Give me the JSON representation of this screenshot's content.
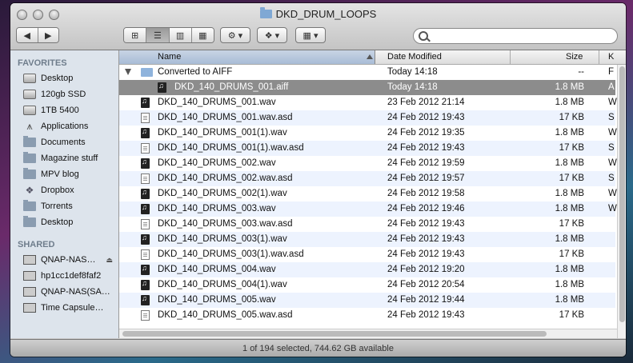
{
  "window": {
    "title": "DKD_DRUM_LOOPS"
  },
  "toolbar": {
    "back_label": "◀",
    "forward_label": "▶",
    "view_icons": [
      "⊞",
      "☰",
      "▥",
      "▦"
    ],
    "action_label": "⚙ ▾",
    "dropbox_label": "❖ ▾",
    "arrange_label": "▦ ▾",
    "search_placeholder": ""
  },
  "sidebar": {
    "favorites_header": "FAVORITES",
    "favorites": [
      {
        "label": "Desktop",
        "icon": "disk-icon"
      },
      {
        "label": "120gb SSD",
        "icon": "disk-icon"
      },
      {
        "label": "1TB 5400",
        "icon": "disk-icon"
      },
      {
        "label": "Applications",
        "icon": "applications-icon"
      },
      {
        "label": "Documents",
        "icon": "folder-icon"
      },
      {
        "label": "Magazine stuff",
        "icon": "folder-icon"
      },
      {
        "label": "MPV blog",
        "icon": "folder-icon"
      },
      {
        "label": "Dropbox",
        "icon": "dropbox-icon"
      },
      {
        "label": "Torrents",
        "icon": "folder-icon"
      },
      {
        "label": "Desktop",
        "icon": "folder-icon"
      }
    ],
    "shared_header": "SHARED",
    "shared": [
      {
        "label": "QNAP-NAS…",
        "icon": "network-icon",
        "eject": "⏏"
      },
      {
        "label": "hp1cc1def8faf2",
        "icon": "network-icon"
      },
      {
        "label": "QNAP-NAS(SA…",
        "icon": "network-icon"
      },
      {
        "label": "Time Capsule…",
        "icon": "network-icon"
      }
    ]
  },
  "columns": {
    "name": "Name",
    "date": "Date Modified",
    "size": "Size",
    "kind": "K"
  },
  "rows": [
    {
      "name": "Converted to AIFF",
      "date": "Today 14:18",
      "size": "--",
      "kind": "F",
      "type": "folder",
      "indent": 0
    },
    {
      "name": "DKD_140_DRUMS_001.aiff",
      "date": "Today 14:18",
      "size": "1.8 MB",
      "kind": "A",
      "type": "audio",
      "indent": 1,
      "selected": true
    },
    {
      "name": "DKD_140_DRUMS_001.wav",
      "date": "23 Feb 2012 21:14",
      "size": "1.8 MB",
      "kind": "W",
      "type": "audio",
      "indent": 0
    },
    {
      "name": "DKD_140_DRUMS_001.wav.asd",
      "date": "24 Feb 2012 19:43",
      "size": "17 KB",
      "kind": "S",
      "type": "doc",
      "indent": 0
    },
    {
      "name": "DKD_140_DRUMS_001(1).wav",
      "date": "24 Feb 2012 19:35",
      "size": "1.8 MB",
      "kind": "W",
      "type": "audio",
      "indent": 0
    },
    {
      "name": "DKD_140_DRUMS_001(1).wav.asd",
      "date": "24 Feb 2012 19:43",
      "size": "17 KB",
      "kind": "S",
      "type": "doc",
      "indent": 0
    },
    {
      "name": "DKD_140_DRUMS_002.wav",
      "date": "24 Feb 2012 19:59",
      "size": "1.8 MB",
      "kind": "W",
      "type": "audio",
      "indent": 0
    },
    {
      "name": "DKD_140_DRUMS_002.wav.asd",
      "date": "24 Feb 2012 19:57",
      "size": "17 KB",
      "kind": "S",
      "type": "doc",
      "indent": 0
    },
    {
      "name": "DKD_140_DRUMS_002(1).wav",
      "date": "24 Feb 2012 19:58",
      "size": "1.8 MB",
      "kind": "W",
      "type": "audio",
      "indent": 0
    },
    {
      "name": "DKD_140_DRUMS_003.wav",
      "date": "24 Feb 2012 19:46",
      "size": "1.8 MB",
      "kind": "W",
      "type": "audio",
      "indent": 0
    },
    {
      "name": "DKD_140_DRUMS_003.wav.asd",
      "date": "24 Feb 2012 19:43",
      "size": "17 KB",
      "kind": "",
      "type": "doc",
      "indent": 0
    },
    {
      "name": "DKD_140_DRUMS_003(1).wav",
      "date": "24 Feb 2012 19:43",
      "size": "1.8 MB",
      "kind": "",
      "type": "audio",
      "indent": 0
    },
    {
      "name": "DKD_140_DRUMS_003(1).wav.asd",
      "date": "24 Feb 2012 19:43",
      "size": "17 KB",
      "kind": "",
      "type": "doc",
      "indent": 0
    },
    {
      "name": "DKD_140_DRUMS_004.wav",
      "date": "24 Feb 2012 19:20",
      "size": "1.8 MB",
      "kind": "",
      "type": "audio",
      "indent": 0
    },
    {
      "name": "DKD_140_DRUMS_004(1).wav",
      "date": "24 Feb 2012 20:54",
      "size": "1.8 MB",
      "kind": "",
      "type": "audio",
      "indent": 0
    },
    {
      "name": "DKD_140_DRUMS_005.wav",
      "date": "24 Feb 2012 19:44",
      "size": "1.8 MB",
      "kind": "",
      "type": "audio",
      "indent": 0
    },
    {
      "name": "DKD_140_DRUMS_005.wav.asd",
      "date": "24 Feb 2012 19:43",
      "size": "17 KB",
      "kind": "",
      "type": "doc",
      "indent": 0
    }
  ],
  "status": {
    "text": "1 of 194 selected, 744.62 GB available"
  }
}
